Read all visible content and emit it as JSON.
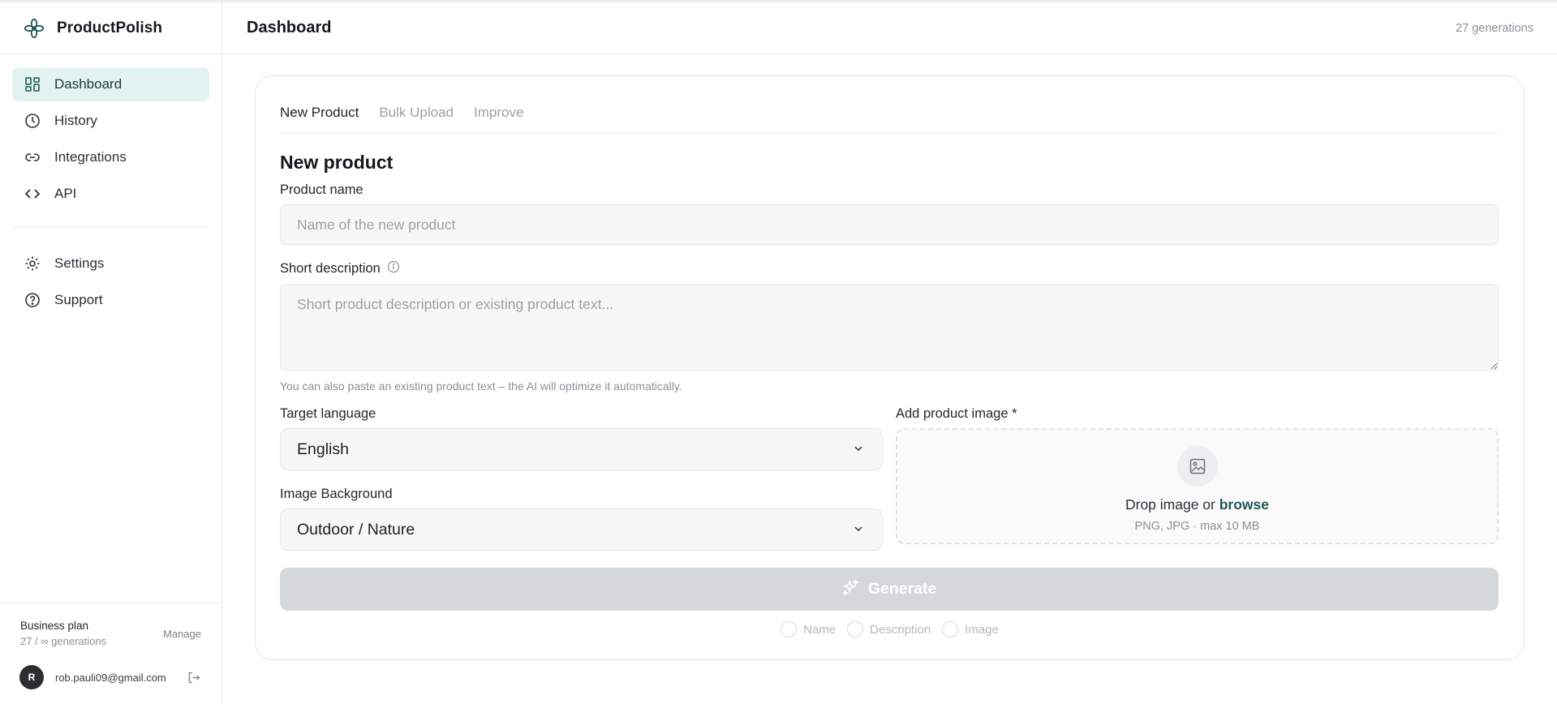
{
  "app": {
    "name": "ProductPolish"
  },
  "sidebar": {
    "nav": [
      {
        "label": "Dashboard",
        "icon": "dashboard-icon",
        "active": true
      },
      {
        "label": "History",
        "icon": "clock-icon"
      },
      {
        "label": "Integrations",
        "icon": "link-icon"
      },
      {
        "label": "API",
        "icon": "code-icon"
      }
    ],
    "secondary": [
      {
        "label": "Settings",
        "icon": "gear-icon"
      },
      {
        "label": "Support",
        "icon": "help-icon"
      }
    ],
    "plan": {
      "name": "Business plan",
      "usage": "27 / ∞ generations",
      "manage_label": "Manage"
    },
    "user": {
      "initial": "R",
      "email": "rob.pauli09@gmail.com"
    }
  },
  "header": {
    "title": "Dashboard",
    "generations": "27 generations"
  },
  "tabs": [
    {
      "label": "New Product",
      "active": true
    },
    {
      "label": "Bulk Upload"
    },
    {
      "label": "Improve"
    }
  ],
  "form": {
    "title": "New product",
    "product_name": {
      "label": "Product name",
      "placeholder": "Name of the new product",
      "value": ""
    },
    "short_description": {
      "label": "Short description",
      "placeholder": "Short product description or existing product text...",
      "hint": "You can also paste an existing product text – the AI will optimize it automatically."
    },
    "target_language": {
      "label": "Target language",
      "value": "English"
    },
    "image_background": {
      "label": "Image Background",
      "value": "Outdoor / Nature"
    },
    "image_upload": {
      "label": "Add product image *",
      "drop_text": "Drop image or ",
      "browse_label": "browse",
      "formats": "PNG, JPG · max 10 MB"
    },
    "generate_label": "Generate",
    "options": [
      {
        "label": "Name"
      },
      {
        "label": "Description"
      },
      {
        "label": "Image"
      }
    ]
  },
  "colors": {
    "accent": "#1f5a52",
    "active_nav_bg": "#e3f3f1",
    "disabled_button": "#d5d8db"
  }
}
